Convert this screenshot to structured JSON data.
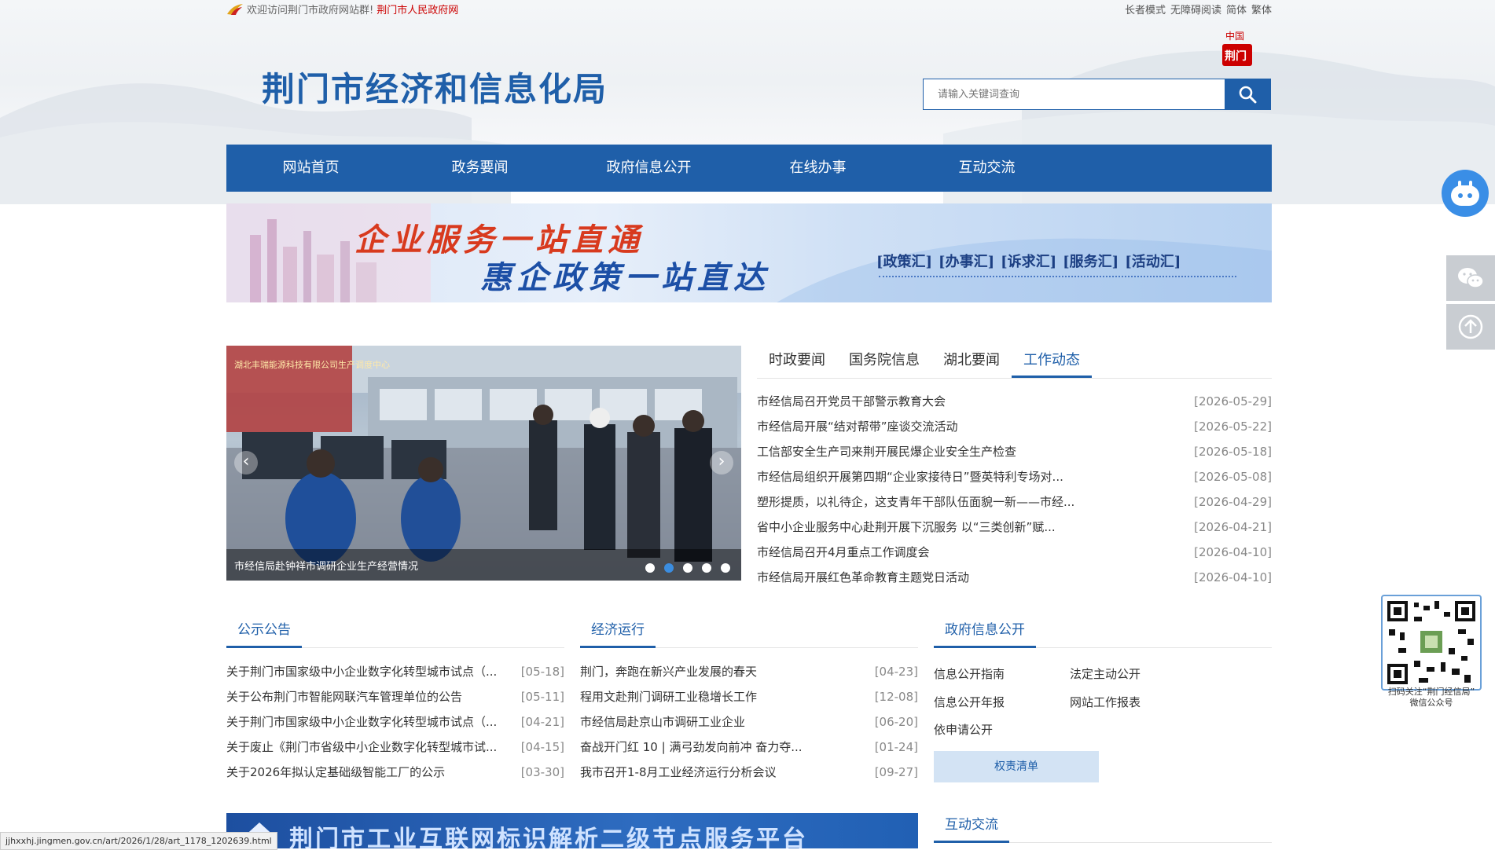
{
  "topbar": {
    "welcome": "欢迎访问荆门市政府网站群!",
    "gov_link": "荆门市人民政府网",
    "links": [
      "长者模式",
      "无障碍阅读",
      "简体",
      "繁体"
    ]
  },
  "header": {
    "title": "荆门市经济和信息化局",
    "seal_text": "中国荆门",
    "search_placeholder": "请输入关键词查询"
  },
  "nav": [
    "网站首页",
    "政务要闻",
    "政府信息公开",
    "在线办事",
    "互动交流"
  ],
  "banner": {
    "line1": "企业服务一站直通",
    "line2": "惠企政策一站直达",
    "tags": [
      "[政策汇]",
      "[办事汇]",
      "[诉求汇]",
      "[服务汇]",
      "[活动汇]"
    ]
  },
  "carousel": {
    "caption": "市经信局赴钟祥市调研企业生产经营情况",
    "sign_text": "湖北丰瑞能源科技有限公司生产调度中心",
    "dot_count": 5,
    "active_dot": 1
  },
  "news": {
    "tabs": [
      "时政要闻",
      "国务院信息",
      "湖北要闻",
      "工作动态"
    ],
    "active_tab": 3,
    "items": [
      {
        "title": "市经信局召开党员干部警示教育大会",
        "date": "[2026-05-29]"
      },
      {
        "title": "市经信局开展“结对帮带”座谈交流活动",
        "date": "[2026-05-22]"
      },
      {
        "title": "工信部安全生产司来荆开展民爆企业安全生产检查",
        "date": "[2026-05-18]"
      },
      {
        "title": "市经信局组织开展第四期“企业家接待日”暨英特利专场对...",
        "date": "[2026-05-08]"
      },
      {
        "title": "塑形提质，以礼待企，这支青年干部队伍面貌一新——市经...",
        "date": "[2026-04-29]"
      },
      {
        "title": "省中小企业服务中心赴荆开展下沉服务 以“三类创新”赋...",
        "date": "[2026-04-21]"
      },
      {
        "title": "市经信局召开4月重点工作调度会",
        "date": "[2026-04-10]"
      },
      {
        "title": "市经信局开展红色革命教育主题党日活动",
        "date": "[2026-04-10]"
      }
    ]
  },
  "notice": {
    "title": "公示公告",
    "items": [
      {
        "title": "关于荆门市国家级中小企业数字化转型城市试点（...",
        "date": "[05-18]"
      },
      {
        "title": "关于公布荆门市智能网联汽车管理单位的公告",
        "date": "[05-11]"
      },
      {
        "title": "关于荆门市国家级中小企业数字化转型城市试点（...",
        "date": "[04-21]"
      },
      {
        "title": "关于废止《荆门市省级中小企业数字化转型城市试...",
        "date": "[04-15]"
      },
      {
        "title": "关于2026年拟认定基础级智能工厂的公示",
        "date": "[03-30]"
      }
    ]
  },
  "economy": {
    "title": "经济运行",
    "items": [
      {
        "title": "荆门，奔跑在新兴产业发展的春天",
        "date": "[04-23]"
      },
      {
        "title": "程用文赴荆门调研工业稳增长工作",
        "date": "[12-08]"
      },
      {
        "title": "市经信局赴京山市调研工业企业",
        "date": "[06-20]"
      },
      {
        "title": "奋战开门红 10 | 满弓劲发向前冲 奋力夺...",
        "date": "[01-24]"
      },
      {
        "title": "我市召开1-8月工业经济运行分析会议",
        "date": "[09-27]"
      }
    ]
  },
  "gov_info": {
    "title": "政府信息公开",
    "links": [
      "信息公开指南",
      "法定主动公开",
      "信息公开年报",
      "网站工作报表",
      "依申请公开"
    ],
    "power_button": "权责清单"
  },
  "interaction": {
    "title": "互动交流"
  },
  "platform_banner": {
    "text": "荆门市工业互联网标识解析二级节点服务平台"
  },
  "qr": {
    "caption_line1": "扫码关注“荆门经信局”",
    "caption_line2": "微信公众号"
  },
  "status_url": "jjhxxhj.jingmen.gov.cn/art/2026/1/28/art_1178_1202639.html",
  "colors": {
    "brand": "#1f5fa9",
    "accent_red": "#c00000",
    "dot_active": "#3b8de0"
  }
}
